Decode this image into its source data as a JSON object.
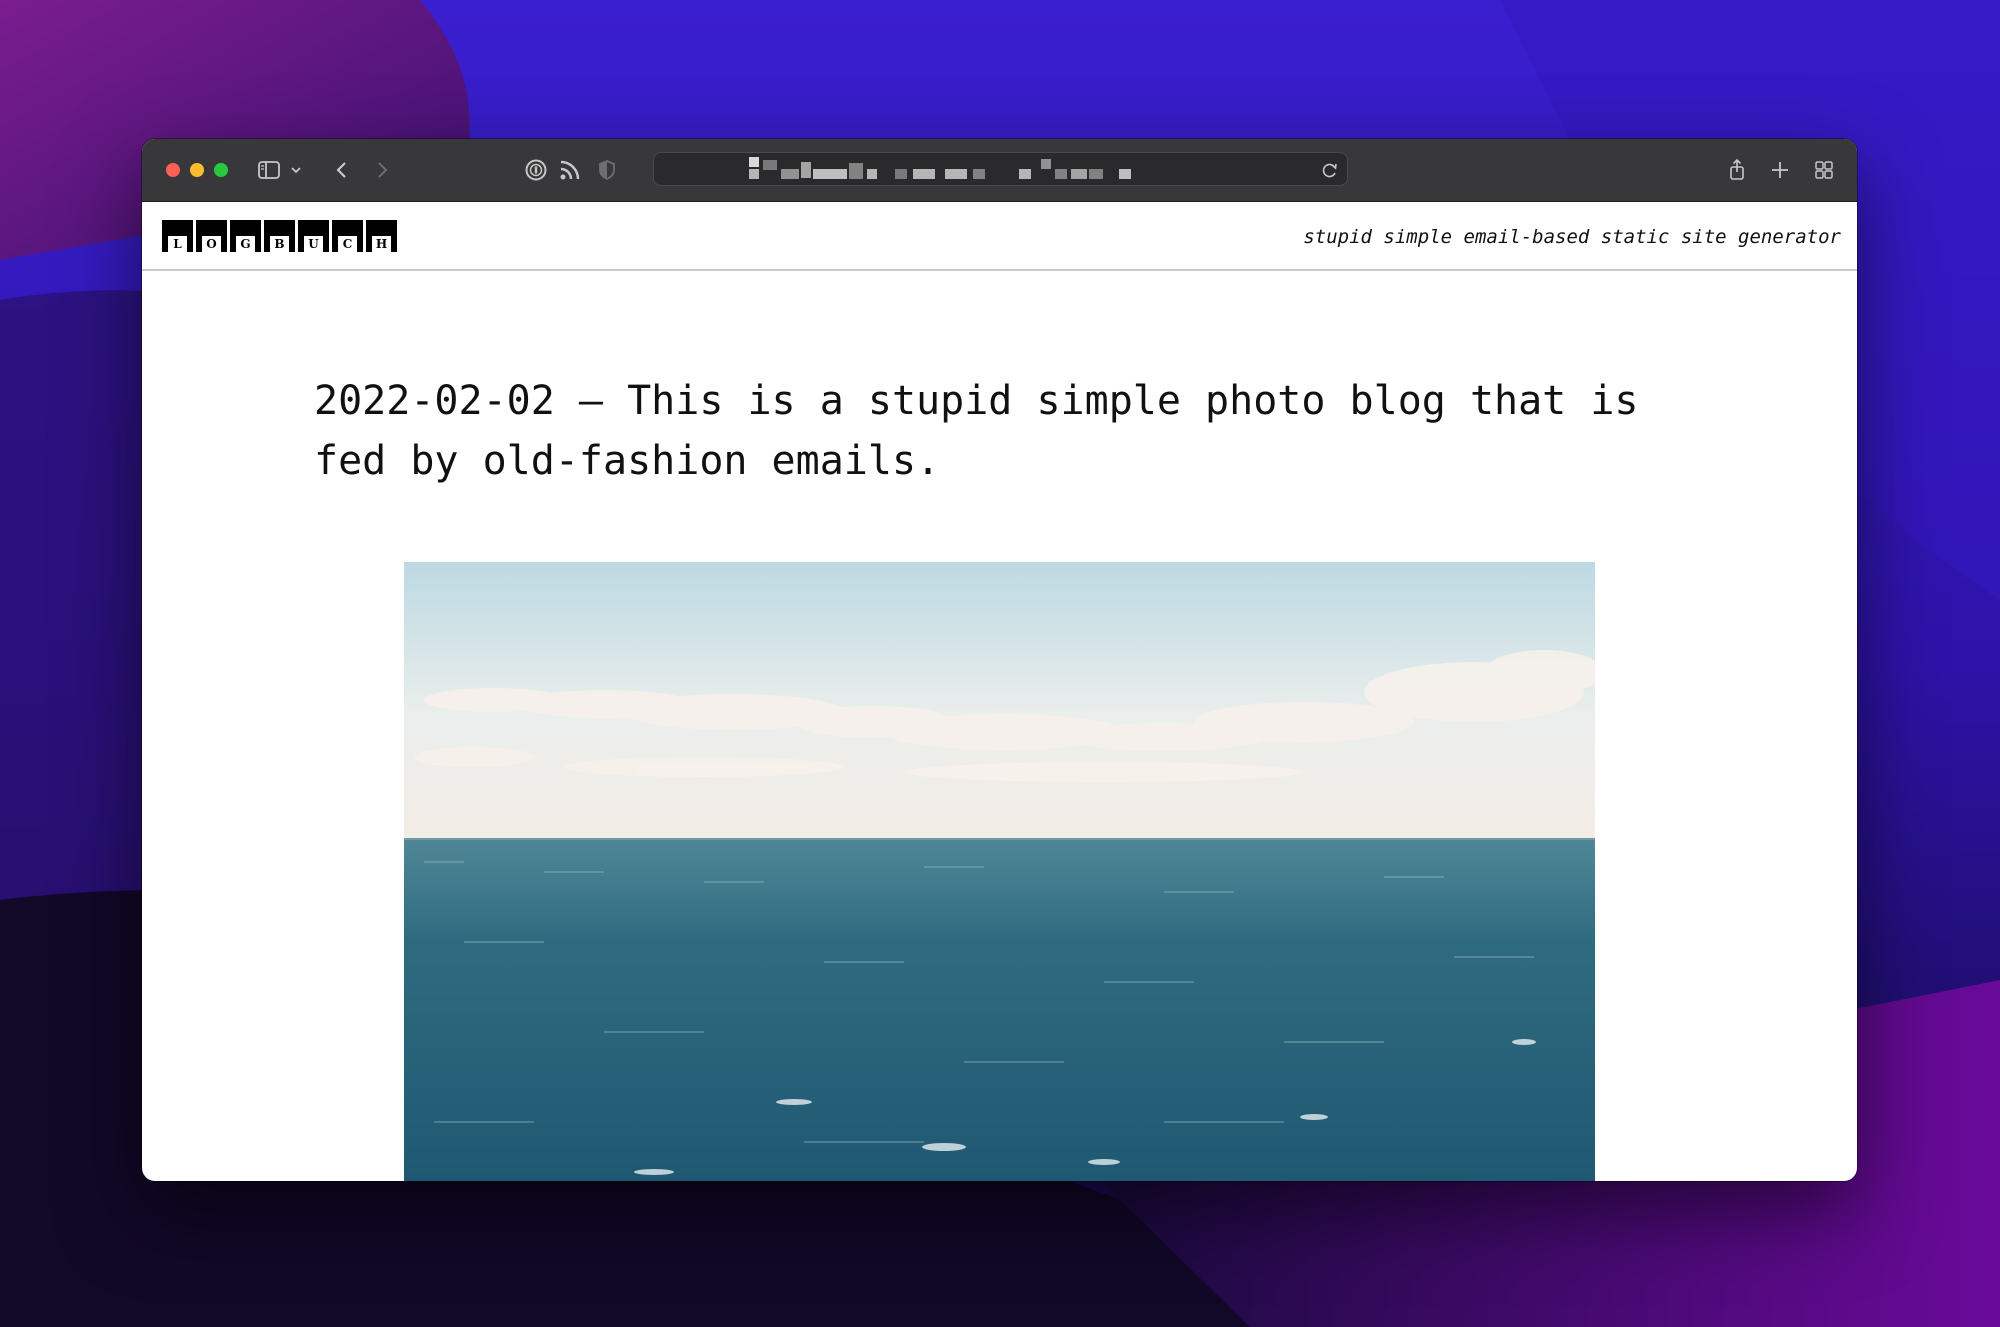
{
  "browser": {
    "traffic_lights": [
      "close",
      "minimize",
      "zoom"
    ],
    "url_redacted": true,
    "icons": [
      "sidebar-icon",
      "chevron-down-icon",
      "back-icon",
      "forward-icon",
      "password-icon",
      "rss-icon",
      "shield-icon",
      "reload-icon",
      "share-icon",
      "new-tab-icon",
      "tab-overview-icon"
    ]
  },
  "site": {
    "logo_letters": [
      "L",
      "O",
      "G",
      "B",
      "U",
      "C",
      "H"
    ],
    "tagline": "stupid simple email-based static site generator"
  },
  "post": {
    "title": "2022-02-02 – This is a stupid simple photo blog that is fed by old-fashion emails."
  },
  "colors": {
    "toolbar": "#38383a",
    "sea": "#2f6b80",
    "sky": "#dde9ee"
  }
}
